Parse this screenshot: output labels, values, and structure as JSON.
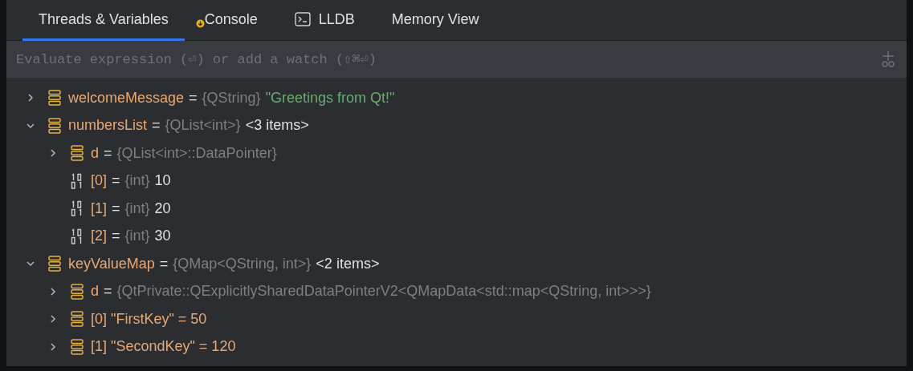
{
  "tabs": [
    {
      "label": "Threads & Variables",
      "selected": true
    },
    {
      "label": "Console",
      "selected": false,
      "kind": "console"
    },
    {
      "label": "LLDB",
      "selected": false,
      "kind": "terminal"
    },
    {
      "label": "Memory View",
      "selected": false
    }
  ],
  "search": {
    "placeholder": "Evaluate expression (⏎) or add a watch (⇧⌘⏎)"
  },
  "variables": [
    {
      "name": "welcomeMessage",
      "sep": "=",
      "type": "{QString}",
      "value": "\"Greetings from Qt!\"",
      "is_string": true,
      "kind": "object",
      "expanded": false
    },
    {
      "name": "numbersList",
      "sep": "=",
      "type": "{QList<int>}",
      "value": "<3 items>",
      "is_string": false,
      "kind": "object",
      "expanded": true,
      "children": [
        {
          "name": "d",
          "sep": "=",
          "type": "{QList<int>::DataPointer}",
          "kind": "object",
          "expanded": false
        },
        {
          "name": "[0]",
          "sep": "=",
          "type": "{int}",
          "value": "10",
          "is_string": false,
          "kind": "primitive"
        },
        {
          "name": "[1]",
          "sep": "=",
          "type": "{int}",
          "value": "20",
          "is_string": false,
          "kind": "primitive"
        },
        {
          "name": "[2]",
          "sep": "=",
          "type": "{int}",
          "value": "30",
          "is_string": false,
          "kind": "primitive"
        }
      ]
    },
    {
      "name": "keyValueMap",
      "sep": "=",
      "type": "{QMap<QString, int>}",
      "value": "<2 items>",
      "is_string": false,
      "kind": "object",
      "expanded": true,
      "children": [
        {
          "name": "d",
          "sep": "=",
          "type": "{QtPrivate::QExplicitlySharedDataPointerV2<QMapData<std::map<QString, int>>>}",
          "kind": "object",
          "expanded": false
        },
        {
          "name": "[0] \"FirstKey\" = 50",
          "kind": "object",
          "expanded": false
        },
        {
          "name": "[1] \"SecondKey\" = 120",
          "kind": "object",
          "expanded": false
        }
      ]
    }
  ]
}
